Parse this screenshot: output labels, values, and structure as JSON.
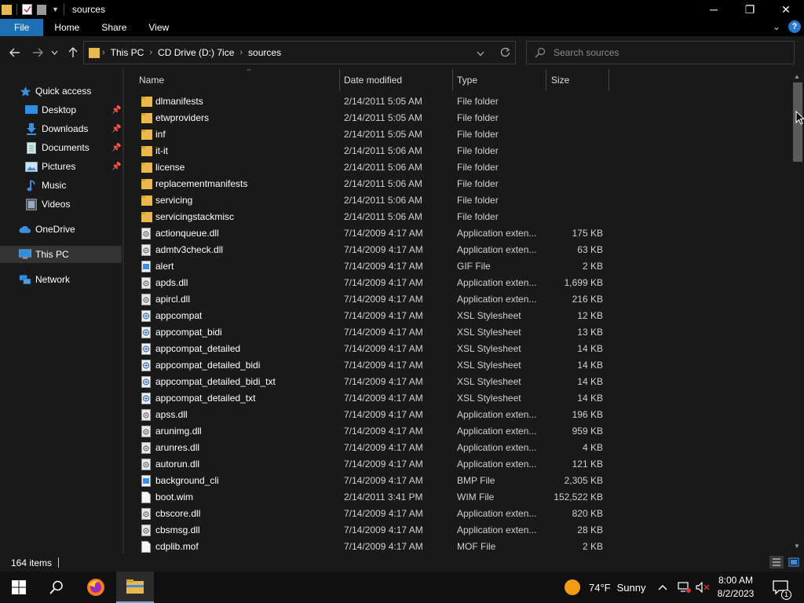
{
  "window": {
    "title": "sources",
    "controls": {
      "minimize": "─",
      "maximize": "❐",
      "close": "✕"
    }
  },
  "ribbon": {
    "tabs": [
      "File",
      "Home",
      "Share",
      "View"
    ]
  },
  "address": {
    "crumbs": [
      "This PC",
      "CD Drive (D:) 7ice",
      "sources"
    ],
    "search_placeholder": "Search sources"
  },
  "nav": {
    "quick_access": "Quick access",
    "items": [
      {
        "label": "Desktop",
        "icon": "desktop-icon",
        "pinned": true
      },
      {
        "label": "Downloads",
        "icon": "download-icon",
        "pinned": true
      },
      {
        "label": "Documents",
        "icon": "documents-icon",
        "pinned": true
      },
      {
        "label": "Pictures",
        "icon": "pictures-icon",
        "pinned": true
      },
      {
        "label": "Music",
        "icon": "music-icon",
        "pinned": false
      },
      {
        "label": "Videos",
        "icon": "videos-icon",
        "pinned": false
      }
    ],
    "onedrive": "OneDrive",
    "this_pc": "This PC",
    "network": "Network"
  },
  "columns": {
    "name": "Name",
    "date": "Date modified",
    "type": "Type",
    "size": "Size"
  },
  "files": [
    {
      "name": "dlmanifests",
      "date": "2/14/2011 5:05 AM",
      "type": "File folder",
      "size": "",
      "icon": "folder"
    },
    {
      "name": "etwproviders",
      "date": "2/14/2011 5:05 AM",
      "type": "File folder",
      "size": "",
      "icon": "folder"
    },
    {
      "name": "inf",
      "date": "2/14/2011 5:05 AM",
      "type": "File folder",
      "size": "",
      "icon": "folder"
    },
    {
      "name": "it-it",
      "date": "2/14/2011 5:06 AM",
      "type": "File folder",
      "size": "",
      "icon": "folder"
    },
    {
      "name": "license",
      "date": "2/14/2011 5:06 AM",
      "type": "File folder",
      "size": "",
      "icon": "folder"
    },
    {
      "name": "replacementmanifests",
      "date": "2/14/2011 5:06 AM",
      "type": "File folder",
      "size": "",
      "icon": "folder"
    },
    {
      "name": "servicing",
      "date": "2/14/2011 5:06 AM",
      "type": "File folder",
      "size": "",
      "icon": "folder"
    },
    {
      "name": "servicingstackmisc",
      "date": "2/14/2011 5:06 AM",
      "type": "File folder",
      "size": "",
      "icon": "folder"
    },
    {
      "name": "actionqueue.dll",
      "date": "7/14/2009 4:17 AM",
      "type": "Application exten...",
      "size": "175 KB",
      "icon": "dll"
    },
    {
      "name": "admtv3check.dll",
      "date": "7/14/2009 4:17 AM",
      "type": "Application exten...",
      "size": "63 KB",
      "icon": "dll"
    },
    {
      "name": "alert",
      "date": "7/14/2009 4:17 AM",
      "type": "GIF File",
      "size": "2 KB",
      "icon": "image"
    },
    {
      "name": "apds.dll",
      "date": "7/14/2009 4:17 AM",
      "type": "Application exten...",
      "size": "1,699 KB",
      "icon": "dll"
    },
    {
      "name": "apircl.dll",
      "date": "7/14/2009 4:17 AM",
      "type": "Application exten...",
      "size": "216 KB",
      "icon": "dll"
    },
    {
      "name": "appcompat",
      "date": "7/14/2009 4:17 AM",
      "type": "XSL Stylesheet",
      "size": "12 KB",
      "icon": "xsl"
    },
    {
      "name": "appcompat_bidi",
      "date": "7/14/2009 4:17 AM",
      "type": "XSL Stylesheet",
      "size": "13 KB",
      "icon": "xsl"
    },
    {
      "name": "appcompat_detailed",
      "date": "7/14/2009 4:17 AM",
      "type": "XSL Stylesheet",
      "size": "14 KB",
      "icon": "xsl"
    },
    {
      "name": "appcompat_detailed_bidi",
      "date": "7/14/2009 4:17 AM",
      "type": "XSL Stylesheet",
      "size": "14 KB",
      "icon": "xsl"
    },
    {
      "name": "appcompat_detailed_bidi_txt",
      "date": "7/14/2009 4:17 AM",
      "type": "XSL Stylesheet",
      "size": "14 KB",
      "icon": "xsl"
    },
    {
      "name": "appcompat_detailed_txt",
      "date": "7/14/2009 4:17 AM",
      "type": "XSL Stylesheet",
      "size": "14 KB",
      "icon": "xsl"
    },
    {
      "name": "apss.dll",
      "date": "7/14/2009 4:17 AM",
      "type": "Application exten...",
      "size": "196 KB",
      "icon": "dll"
    },
    {
      "name": "arunimg.dll",
      "date": "7/14/2009 4:17 AM",
      "type": "Application exten...",
      "size": "959 KB",
      "icon": "dll"
    },
    {
      "name": "arunres.dll",
      "date": "7/14/2009 4:17 AM",
      "type": "Application exten...",
      "size": "4 KB",
      "icon": "dll"
    },
    {
      "name": "autorun.dll",
      "date": "7/14/2009 4:17 AM",
      "type": "Application exten...",
      "size": "121 KB",
      "icon": "dll"
    },
    {
      "name": "background_cli",
      "date": "7/14/2009 4:17 AM",
      "type": "BMP File",
      "size": "2,305 KB",
      "icon": "image"
    },
    {
      "name": "boot.wim",
      "date": "2/14/2011 3:41 PM",
      "type": "WIM File",
      "size": "152,522 KB",
      "icon": "blank"
    },
    {
      "name": "cbscore.dll",
      "date": "7/14/2009 4:17 AM",
      "type": "Application exten...",
      "size": "820 KB",
      "icon": "dll"
    },
    {
      "name": "cbsmsg.dll",
      "date": "7/14/2009 4:17 AM",
      "type": "Application exten...",
      "size": "28 KB",
      "icon": "dll"
    },
    {
      "name": "cdplib.mof",
      "date": "7/14/2009 4:17 AM",
      "type": "MOF File",
      "size": "2 KB",
      "icon": "blank"
    }
  ],
  "status": {
    "item_count": "164 items"
  },
  "taskbar": {
    "weather_temp": "74°F",
    "weather_desc": "Sunny",
    "time": "8:00 AM",
    "date": "8/2/2023",
    "notification_count": "1"
  },
  "colors": {
    "accent": "#1f6fb5",
    "folder": "#e8b84a",
    "background": "#191919"
  }
}
